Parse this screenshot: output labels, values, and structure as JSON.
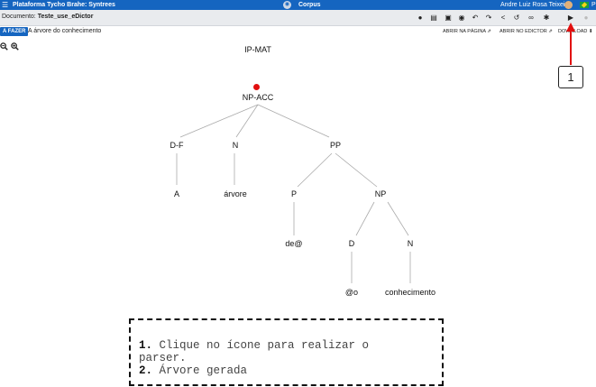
{
  "topbar": {
    "brand": "Plataforma Tycho Brahe: Syntrees",
    "corpus": "Corpus",
    "user": "Andre Luiz Rosa Teixeira",
    "lang": "P"
  },
  "docbar": {
    "doc_label": "Documento:",
    "doc_name": "Teste_use_eDictor"
  },
  "tagrow": {
    "tag": "A FAZER",
    "title": "A árvore do conhecimento",
    "link1": "ABRIR NA PÁGINA",
    "link2": "ABRIR NO EDICTOR",
    "link3": "DOWNLOAD"
  },
  "tree": {
    "root": "IP-MAT",
    "np_acc": "NP-ACC",
    "df": "D-F",
    "n1": "N",
    "pp": "PP",
    "a": "A",
    "arvore": "árvore",
    "p": "P",
    "np": "NP",
    "de": "de@",
    "d": "D",
    "n2": "N",
    "o": "@o",
    "conhecimento": "conhecimento"
  },
  "annotation": {
    "badge": "1",
    "note_num1": "1.",
    "note_line1": " Clique no ícone para realizar o",
    "note_line1b": "parser.",
    "note_num2": "2.",
    "note_line2": " Árvore gerada"
  },
  "colors": {
    "topbar": "#1565c0",
    "annotation_red": "#e10f0f",
    "tag": "#1565c0"
  },
  "icons": [
    "menu-icon",
    "corpus-icon",
    "comment-icon",
    "document-icon",
    "save-icon",
    "eye-icon",
    "undo-icon",
    "redo-icon",
    "share-icon",
    "history-icon",
    "link-icon",
    "bug-icon",
    "play-icon",
    "settings-icon",
    "zoom-in-icon",
    "zoom-out-icon"
  ]
}
